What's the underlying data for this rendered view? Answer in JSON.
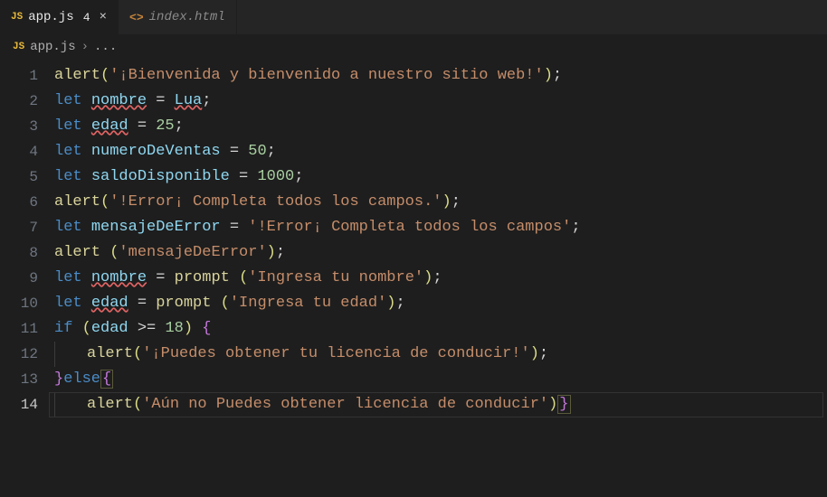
{
  "tabs": [
    {
      "icon": "JS",
      "label": "app.js",
      "badge": "4",
      "close": "×",
      "active": true
    },
    {
      "icon": "<>",
      "label": "index.html",
      "active": false
    }
  ],
  "breadcrumb": {
    "icon": "JS",
    "file": "app.js",
    "sep": "›",
    "more": "..."
  },
  "gutter": {
    "current": 14
  },
  "code": {
    "l1": {
      "fn": "alert",
      "po": "(",
      "str": "'¡Bienvenida y bienvenido a nuestro sitio web!'",
      "pc": ")",
      "semi": ";"
    },
    "l2": {
      "kw": "let ",
      "var": "nombre",
      "op": " = ",
      "val": "Lua",
      "semi": ";"
    },
    "l3": {
      "kw": "let ",
      "var": "edad",
      "op": " = ",
      "num": "25",
      "semi": ";"
    },
    "l4": {
      "kw": "let ",
      "var": "numeroDeVentas",
      "op": " = ",
      "num": "50",
      "semi": ";"
    },
    "l5": {
      "kw": "let ",
      "var": "saldoDisponible",
      "op": " = ",
      "num": "1000",
      "semi": ";"
    },
    "l6": {
      "fn": "alert",
      "po": "(",
      "str": "'!Error¡ Completa todos los campos.'",
      "pc": ")",
      "semi": ";"
    },
    "l7": {
      "kw": "let ",
      "var": "mensajeDeError",
      "op": " = ",
      "str": "'!Error¡ Completa todos los campos'",
      "semi": ";"
    },
    "l8": {
      "fn": "alert ",
      "po": "(",
      "str": "'mensajeDeError'",
      "pc": ")",
      "semi": ";"
    },
    "l9": {
      "kw": "let ",
      "var": "nombre",
      "op": " = ",
      "fn": "prompt ",
      "po": "(",
      "str": "'Ingresa tu nombre'",
      "pc": ")",
      "semi": ";"
    },
    "l10": {
      "kw": "let ",
      "var": "edad",
      "op": " = ",
      "fn": "prompt ",
      "po": "(",
      "str": "'Ingresa tu edad'",
      "pc": ")",
      "semi": ";"
    },
    "l11": {
      "kw": "if ",
      "po": "(",
      "var": "edad",
      "op": " >= ",
      "num": "18",
      "pc": ")",
      "sp": " ",
      "bo": "{"
    },
    "l12": {
      "fn": "alert",
      "po": "(",
      "str": "'¡Puedes obtener tu licencia de conducir!'",
      "pc": ")",
      "semi": ";"
    },
    "l13": {
      "bc": "}",
      "kw": "else",
      "bo": "{"
    },
    "l14": {
      "fn": "alert",
      "po": "(",
      "str": "'Aún no Puedes obtener licencia de conducir'",
      "pc": ")",
      "bc": "}"
    }
  }
}
